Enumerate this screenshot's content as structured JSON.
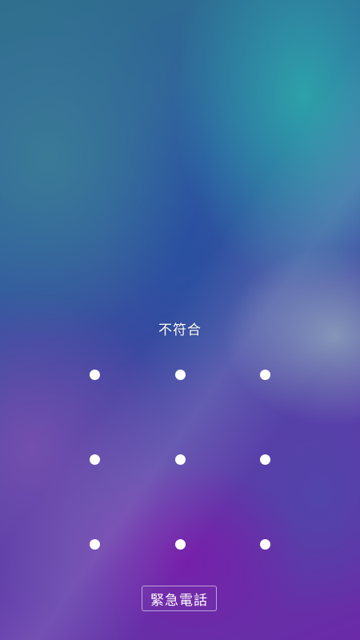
{
  "lock_screen": {
    "status_message": "不符合",
    "pattern": {
      "rows": 3,
      "columns": 3,
      "dot_color": "#ffffff",
      "dots": [
        "dot-1",
        "dot-2",
        "dot-3",
        "dot-4",
        "dot-5",
        "dot-6",
        "dot-7",
        "dot-8",
        "dot-9"
      ]
    },
    "emergency_call_label": "緊急電話"
  },
  "colors": {
    "text": "#ffffff",
    "wallpaper_teal": "#2da5aa",
    "wallpaper_blue": "#2f5ea0",
    "wallpaper_purple": "#6b2aa8"
  }
}
